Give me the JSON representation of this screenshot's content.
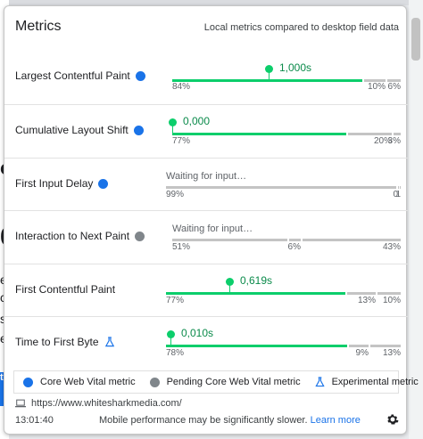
{
  "header": {
    "title": "Metrics",
    "subtitle": "Local metrics compared to desktop field data"
  },
  "metrics": [
    {
      "name": "Largest Contentful Paint",
      "kind": "core",
      "value": "1,000s",
      "dist": [
        "84%",
        "10%",
        "6%"
      ],
      "fractions": [
        0.84,
        0.1,
        0.06
      ],
      "marker_fraction": 0.42
    },
    {
      "name": "Cumulative Layout Shift",
      "kind": "core",
      "value": "0,000",
      "dist": [
        "77%",
        "20%",
        "3%"
      ],
      "fractions": [
        0.77,
        0.2,
        0.03
      ],
      "marker_fraction": 0.0
    },
    {
      "name": "First Input Delay",
      "kind": "core",
      "waiting": "Waiting for input…",
      "dist": [
        "99%",
        "0",
        "1"
      ],
      "fractions": [
        0.99,
        0.005,
        0.005
      ]
    },
    {
      "name": "Interaction to Next Paint",
      "kind": "pending",
      "waiting": "Waiting for input…",
      "dist": [
        "51%",
        "6%",
        "43%"
      ],
      "fractions": [
        0.51,
        0.06,
        0.43
      ]
    },
    {
      "name": "First Contentful Paint",
      "kind": "none",
      "value": "0,619s",
      "dist": [
        "77%",
        "13%",
        "10%"
      ],
      "fractions": [
        0.77,
        0.13,
        0.1
      ],
      "marker_fraction": 0.27
    },
    {
      "name": "Time to First Byte",
      "kind": "experimental",
      "value": "0,010s",
      "dist": [
        "78%",
        "9%",
        "13%"
      ],
      "fractions": [
        0.78,
        0.09,
        0.13
      ],
      "marker_fraction": 0.02
    }
  ],
  "legend": {
    "core": "Core Web Vital metric",
    "pending": "Pending Core Web Vital metric",
    "experimental": "Experimental metric"
  },
  "url": "https://www.whitesharkmedia.com/",
  "footer": {
    "time": "13:01:40",
    "note": "Mobile performance may be significantly slower.",
    "link": "Learn more"
  },
  "background_fragments": [
    "o",
    "0",
    "e",
    "ct",
    "s",
    "e",
    "te"
  ],
  "colors": {
    "good": "#0cce6b",
    "needs_improvement": "#ffa400",
    "poor": "#ff4e42",
    "core_dot": "#1a73e8",
    "pending_dot": "#80868b"
  },
  "icons": {
    "core": "blue-dot-icon",
    "pending": "grey-dot-icon",
    "experimental": "flask-icon",
    "url": "laptop-icon",
    "settings": "gear-icon"
  }
}
